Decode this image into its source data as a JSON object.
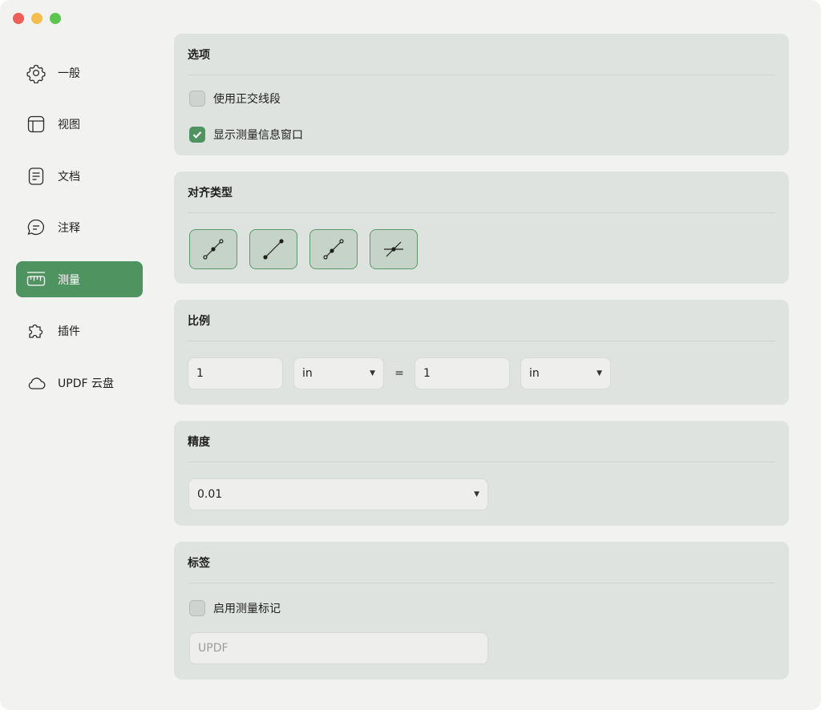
{
  "sidebar": {
    "items": [
      {
        "label": "一般",
        "icon": "gear-icon"
      },
      {
        "label": "视图",
        "icon": "layout-icon"
      },
      {
        "label": "文档",
        "icon": "document-icon"
      },
      {
        "label": "注释",
        "icon": "comment-icon"
      },
      {
        "label": "测量",
        "icon": "ruler-icon",
        "active": true
      },
      {
        "label": "插件",
        "icon": "puzzle-icon"
      },
      {
        "label": "UPDF 云盘",
        "icon": "cloud-icon"
      }
    ]
  },
  "options": {
    "title": "选项",
    "orthogonal_label": "使用正交线段",
    "orthogonal_checked": false,
    "show_info_label": "显示测量信息窗口",
    "show_info_checked": true
  },
  "snap": {
    "title": "对齐类型",
    "buttons": [
      "snap-midpoint-icon",
      "snap-endpoint-icon",
      "snap-path-icon",
      "snap-intersection-icon"
    ]
  },
  "scale": {
    "title": "比例",
    "left_value": "1",
    "left_unit": "in",
    "equals": "=",
    "right_value": "1",
    "right_unit": "in"
  },
  "precision": {
    "title": "精度",
    "value": "0.01"
  },
  "labels": {
    "title": "标签",
    "enable_label": "启用测量标记",
    "enable_checked": false,
    "placeholder": "UPDF"
  },
  "colors": {
    "accent": "#4f9360",
    "card": "#dfe3df",
    "window": "#f2f3f1"
  }
}
